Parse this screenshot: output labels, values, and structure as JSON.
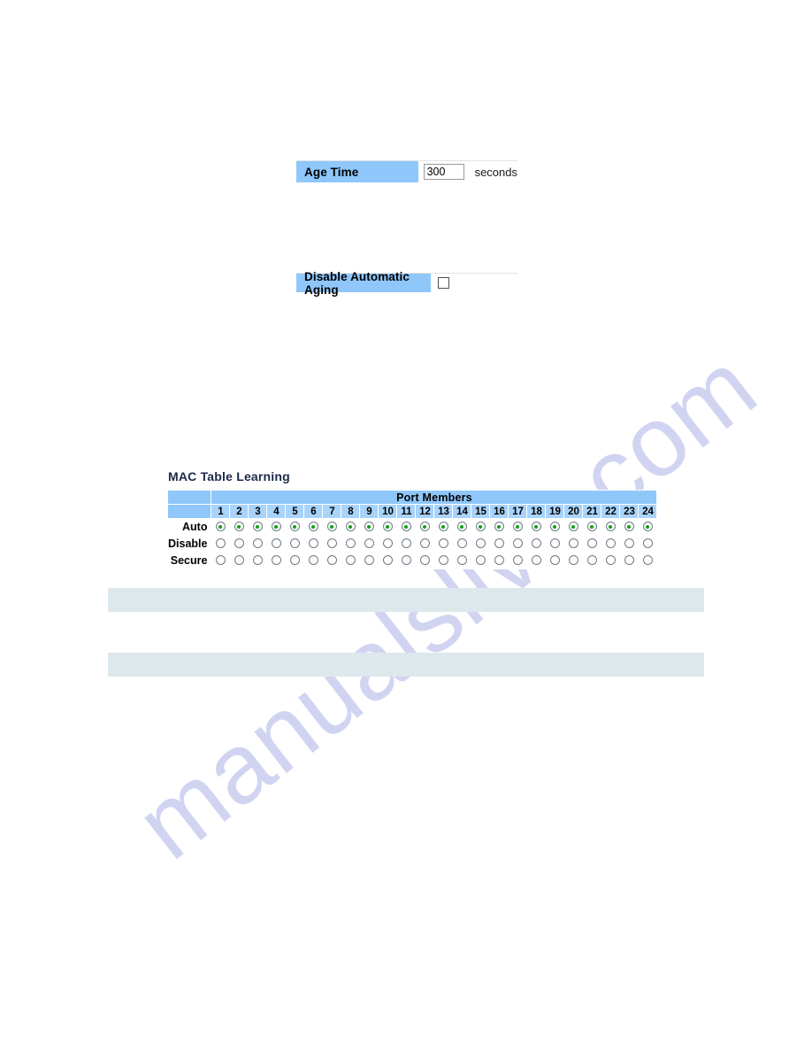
{
  "watermark": {
    "text": "manualslive.com"
  },
  "age_time_row": {
    "label": "Age Time",
    "value": "300",
    "placeholder": "",
    "unit": "seconds"
  },
  "disable_aging_row": {
    "label": "Disable Automatic Aging",
    "checked": false
  },
  "mac_table_learning": {
    "title": "MAC Table Learning",
    "group_header": "Port Members",
    "ports": [
      "1",
      "2",
      "3",
      "4",
      "5",
      "6",
      "7",
      "8",
      "9",
      "10",
      "11",
      "12",
      "13",
      "14",
      "15",
      "16",
      "17",
      "18",
      "19",
      "20",
      "21",
      "22",
      "23",
      "24"
    ],
    "modes": [
      {
        "label": "Auto",
        "selected": true
      },
      {
        "label": "Disable",
        "selected": false
      },
      {
        "label": "Secure",
        "selected": false
      }
    ]
  },
  "info_bars": [
    {
      "text": ""
    },
    {
      "text": ""
    }
  ],
  "colors": {
    "label_blue": "#8fc7fb",
    "port_header_blue": "#a8d3fb",
    "info_bar": "#dde8ec",
    "radio_green": "#12a012",
    "title_navy": "#1b2a4a",
    "watermark": "#c9cdef"
  }
}
